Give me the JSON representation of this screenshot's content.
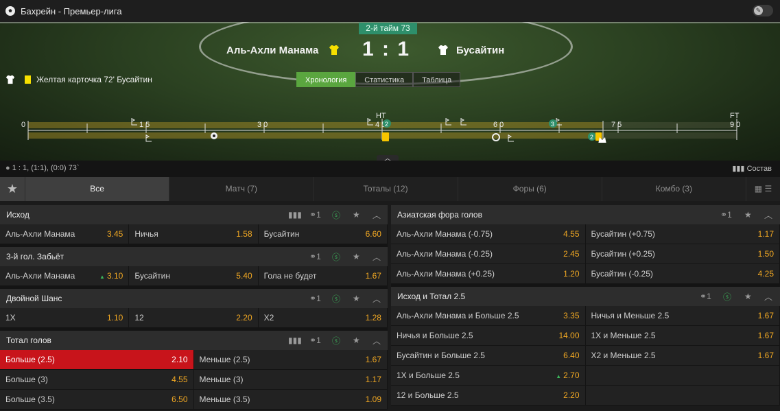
{
  "header": {
    "title": "Бахрейн - Премьер-лига",
    "ball_icon": "football-icon",
    "toggle_icon": "pin-icon"
  },
  "match": {
    "period": "2-й тайм 73",
    "home": "Аль-Ахли Манама",
    "away": "Бусайтин",
    "score_home": "1",
    "score_sep": ":",
    "score_away": "1",
    "home_color": "#f7e000",
    "away_color": "#ffffff"
  },
  "event": {
    "text": "Желтая карточка 72' Бусайтин"
  },
  "view_tabs": [
    {
      "label": "Хронология",
      "active": true
    },
    {
      "label": "Статистика"
    },
    {
      "label": "Таблица"
    }
  ],
  "timeline": {
    "ticks": [
      {
        "label": "0"
      },
      {
        "label": "1 5"
      },
      {
        "label": "3 0"
      },
      {
        "label": "4 5"
      },
      {
        "label": "6 0"
      },
      {
        "label": "7 5"
      },
      {
        "label": "9 0"
      }
    ],
    "ht": "HT",
    "ft": "FT",
    "badge_ht": "2",
    "badge_70": "3",
    "badge_72": "2"
  },
  "annotation": {
    "left": "1 : 1, (1:1), (0:0) 73`",
    "right": "Состав"
  },
  "market_tabs": [
    "Все",
    "Матч (7)",
    "Тоталы (12)",
    "Форы (6)",
    "Комбо (3)"
  ],
  "counts": {
    "link": "1"
  },
  "left": [
    {
      "title": "Исход",
      "stats": true,
      "rows": [
        [
          {
            "n": "Аль-Ахли Манама",
            "o": "3.45"
          },
          {
            "n": "Ничья",
            "o": "1.58"
          },
          {
            "n": "Бусайтин",
            "o": "6.60"
          }
        ]
      ]
    },
    {
      "title": "3-й гол. Забьёт",
      "rows": [
        [
          {
            "n": "Аль-Ахли Манама",
            "o": "3.10",
            "up": true
          },
          {
            "n": "Бусайтин",
            "o": "5.40"
          },
          {
            "n": "Гола не будет",
            "o": "1.67"
          }
        ]
      ]
    },
    {
      "title": "Двойной Шанс",
      "rows": [
        [
          {
            "n": "1X",
            "o": "1.10"
          },
          {
            "n": "12",
            "o": "2.20"
          },
          {
            "n": "X2",
            "o": "1.28"
          }
        ]
      ]
    },
    {
      "title": "Тотал голов",
      "stats": true,
      "rows": [
        [
          {
            "n": "Больше (2.5)",
            "o": "2.10",
            "sel": true
          },
          {
            "n": "Меньше (2.5)",
            "o": "1.67"
          }
        ],
        [
          {
            "n": "Больше (3)",
            "o": "4.55"
          },
          {
            "n": "Меньше (3)",
            "o": "1.17"
          }
        ],
        [
          {
            "n": "Больше (3.5)",
            "o": "6.50"
          },
          {
            "n": "Меньше (3.5)",
            "o": "1.09"
          }
        ]
      ]
    }
  ],
  "right": [
    {
      "title": "Азиатская фора голов",
      "rows": [
        [
          {
            "n": "Аль-Ахли Манама (-0.75)",
            "o": "4.55"
          },
          {
            "n": "Бусайтин (+0.75)",
            "o": "1.17"
          }
        ],
        [
          {
            "n": "Аль-Ахли Манама (-0.25)",
            "o": "2.45"
          },
          {
            "n": "Бусайтин (+0.25)",
            "o": "1.50"
          }
        ],
        [
          {
            "n": "Аль-Ахли Манама (+0.25)",
            "o": "1.20"
          },
          {
            "n": "Бусайтин (-0.25)",
            "o": "4.25"
          }
        ]
      ]
    },
    {
      "title": "Исход и Тотал 2.5",
      "rows": [
        [
          {
            "n": "Аль-Ахли Манама и Больше 2.5",
            "o": "3.35"
          },
          {
            "n": "Ничья и Меньше 2.5",
            "o": "1.67"
          }
        ],
        [
          {
            "n": "Ничья и Больше 2.5",
            "o": "14.00"
          },
          {
            "n": "1X и Меньше 2.5",
            "o": "1.67"
          }
        ],
        [
          {
            "n": "Бусайтин и Больше 2.5",
            "o": "6.40"
          },
          {
            "n": "X2 и Меньше 2.5",
            "o": "1.67"
          }
        ],
        [
          {
            "n": "1X и Больше 2.5",
            "o": "2.70",
            "up": true
          },
          {
            "n": "",
            "o": ""
          }
        ],
        [
          {
            "n": "12 и Больше 2.5",
            "o": "2.20"
          },
          {
            "n": "",
            "o": ""
          }
        ]
      ]
    }
  ]
}
